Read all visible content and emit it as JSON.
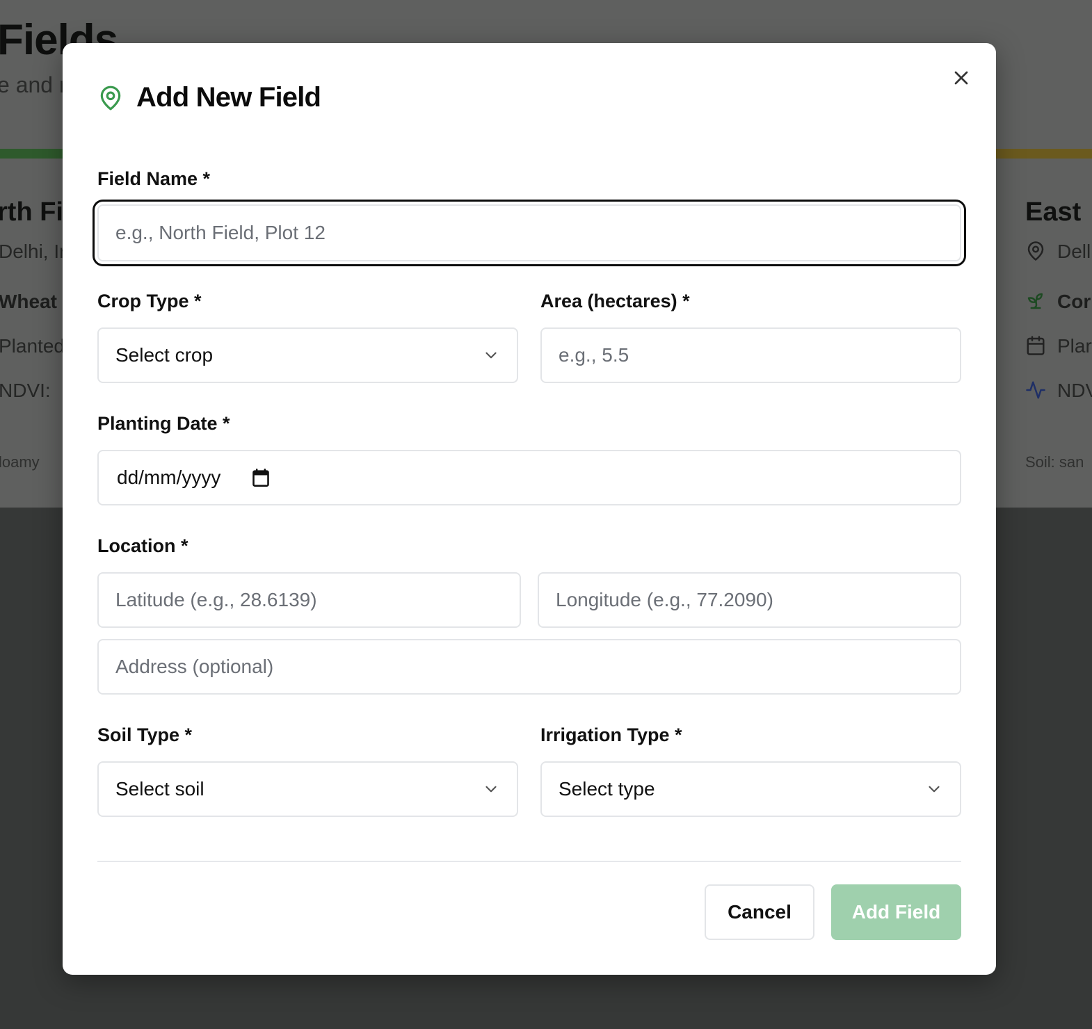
{
  "background": {
    "page_title": "Fields",
    "page_subtitle": "e and r",
    "left_card": {
      "name": "rth Fi",
      "location": "Delhi, Ir",
      "crop": "Wheat",
      "planted": "Planted",
      "ndvi": "NDVI:",
      "soil": "loamy"
    },
    "right_card": {
      "name": "East",
      "location": "Dell",
      "crop": "Cor",
      "planted": "Plar",
      "ndvi": "NDV",
      "soil": "Soil: san"
    },
    "colors": {
      "left_accent": "#2e5a2c",
      "right_accent": "#6b5a1e"
    }
  },
  "modal": {
    "title": "Add New Field",
    "header_icon": "map-pin-icon",
    "close_icon": "close-icon",
    "fields": {
      "field_name": {
        "label": "Field Name *",
        "placeholder": "e.g., North Field, Plot 12"
      },
      "crop_type": {
        "label": "Crop Type *",
        "value": "Select crop"
      },
      "area": {
        "label": "Area (hectares) *",
        "placeholder": "e.g., 5.5"
      },
      "planting_date": {
        "label": "Planting Date *",
        "value": "dd/mm/yyyy"
      },
      "location": {
        "label": "Location *",
        "latitude_placeholder": "Latitude (e.g., 28.6139)",
        "longitude_placeholder": "Longitude (e.g., 77.2090)",
        "address_placeholder": "Address (optional)"
      },
      "soil_type": {
        "label": "Soil Type *",
        "value": "Select soil"
      },
      "irrigation_type": {
        "label": "Irrigation Type *",
        "value": "Select type"
      }
    },
    "buttons": {
      "cancel": "Cancel",
      "submit": "Add Field"
    },
    "colors": {
      "accent": "#3a9a4e",
      "submit_disabled": "#9fd0ad",
      "focus_ring": "#0d0d0d"
    }
  }
}
